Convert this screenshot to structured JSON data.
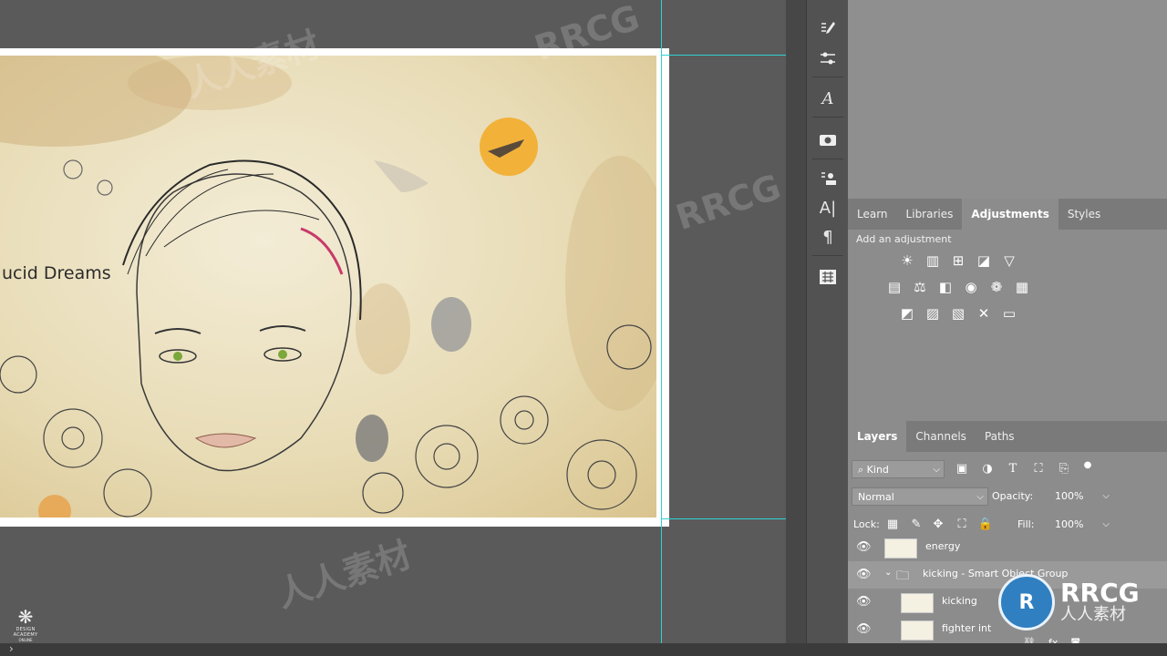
{
  "canvas": {
    "artwork_title": "ucid Dreams"
  },
  "toolstrip": {
    "icons": [
      "brush-settings-icon",
      "adjust-sliders-icon",
      "glyph-icon",
      "camera-icon",
      "paragraph-styles-icon",
      "character-icon",
      "paragraph-icon",
      "properties-icon"
    ]
  },
  "top_panel_tabs": {
    "learn": "Learn",
    "libraries": "Libraries",
    "adjustments": "Adjustments",
    "styles": "Styles"
  },
  "adjustments": {
    "label": "Add an adjustment",
    "row1": [
      "☀",
      "▥",
      "⊞",
      "◪",
      "▽"
    ],
    "row2": [
      "▤",
      "⚖",
      "◧",
      "◉",
      "❁",
      "▦"
    ],
    "row3": [
      "◩",
      "▨",
      "▧",
      "✕",
      "▭"
    ]
  },
  "layers_tabs": {
    "layers": "Layers",
    "channels": "Channels",
    "paths": "Paths"
  },
  "layers": {
    "filter_kind": "Kind",
    "blend_mode": "Normal",
    "opacity_label": "Opacity:",
    "opacity_value": "100%",
    "lock_label": "Lock:",
    "fill_label": "Fill:",
    "fill_value": "100%",
    "rows": [
      {
        "name": "energy"
      },
      {
        "name": "kicking - Smart Object Group"
      },
      {
        "name": "kicking"
      },
      {
        "name": "fighter int"
      }
    ]
  },
  "logo": {
    "line1": "DESIGN ACADEMY",
    "line2": "ONLINE"
  },
  "watermark": {
    "brand": "RRCG",
    "sub": "人人素材"
  },
  "colors": {
    "guide": "#2fd1d1",
    "panel_bg": "#8c8c8c",
    "canvas_bg": "#5a5a5a"
  }
}
